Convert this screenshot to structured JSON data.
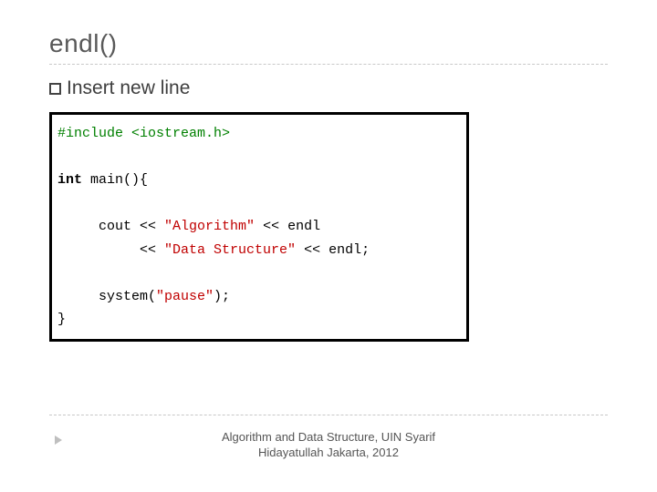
{
  "title": "endl()",
  "bullet": "Insert new line",
  "code": {
    "l1_include": "#include <iostream.h>",
    "l2_int": "int",
    "l2_rest": " main(){",
    "l3_pre": "     cout << ",
    "l3_str": "\"Algorithm\"",
    "l3_post": " << endl",
    "l4_pre": "          << ",
    "l4_str": "\"Data Structure\"",
    "l4_post": " << endl;",
    "l5_pre": "     system(",
    "l5_str": "\"pause\"",
    "l5_post": ");",
    "l6": "}"
  },
  "footer": {
    "line1": "Algorithm and Data Structure, UIN Syarif",
    "line2": "Hidayatullah Jakarta, 2012"
  }
}
